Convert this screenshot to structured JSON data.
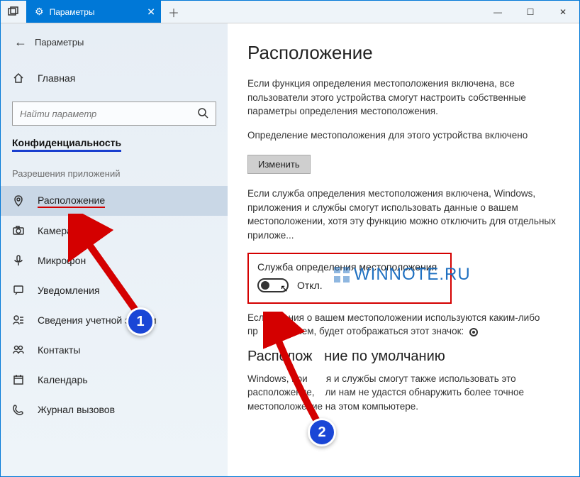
{
  "titlebar": {
    "tab_label": "Параметры",
    "app_label": "Параметры"
  },
  "sidebar": {
    "home": "Главная",
    "search_placeholder": "Найти параметр",
    "section": "Конфиденциальность",
    "group": "Разрешения приложений",
    "items": [
      {
        "label": "Расположение",
        "selected": true
      },
      {
        "label": "Камера"
      },
      {
        "label": "Микрофон"
      },
      {
        "label": "Уведомления"
      },
      {
        "label": "Сведения учетной записи"
      },
      {
        "label": "Контакты"
      },
      {
        "label": "Календарь"
      },
      {
        "label": "Журнал вызовов"
      }
    ]
  },
  "main": {
    "title": "Расположение",
    "para1": "Если функция определения местоположения включена, все пользователи этого устройства смогут настроить собственные параметры определения местоположения.",
    "status_line": "Определение местоположения для этого устройства включено",
    "change_btn": "Изменить",
    "para2_prefix": "Если служба определения местоположения включена, Windows, приложения и службы смогут использовать данные о вашем местоположении, хотя эту функцию можно отключить для отдельных приложе",
    "toggle_label": "Служба определения местоположения",
    "toggle_state": "Откл.",
    "para3_a": "Есл",
    "para3_b": "дения о вашем местоположении используются каким-либо пр",
    "para3_c": "ложением, будет отображаться этот значок:",
    "subsection": "Расположение по умолчанию",
    "para4_a": "Windows, при",
    "para4_b": "я и службы смогут также использовать это расположение,",
    "para4_c": "ли нам не удастся обнаружить более точное местоположение на этом компьютере."
  },
  "watermark": "WINNOTE.RU",
  "anno": {
    "n1": "1",
    "n2": "2"
  }
}
